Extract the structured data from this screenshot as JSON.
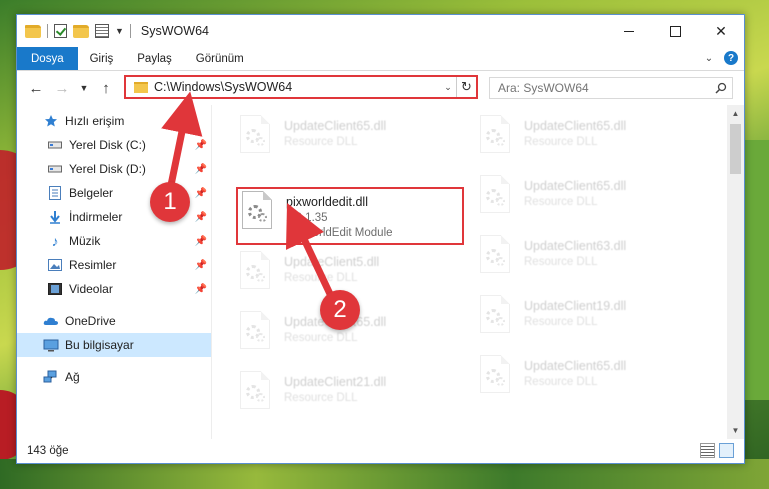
{
  "window": {
    "title": "SysWOW64"
  },
  "ribbon": {
    "tabs": [
      "Dosya",
      "Giriş",
      "Paylaş",
      "Görünüm"
    ],
    "help_symbol": "?"
  },
  "address": {
    "path": "C:\\Windows\\SysWOW64",
    "search_placeholder": "Ara: SysWOW64"
  },
  "nav": {
    "quick_access": "Hızlı erişim",
    "pinned": [
      {
        "label": "Yerel Disk (C:)",
        "icon": "drive-icon"
      },
      {
        "label": "Yerel Disk (D:)",
        "icon": "drive-icon"
      },
      {
        "label": "Belgeler",
        "icon": "documents-icon"
      },
      {
        "label": "İndirmeler",
        "icon": "downloads-icon"
      },
      {
        "label": "Müzik",
        "icon": "music-icon"
      },
      {
        "label": "Resimler",
        "icon": "pictures-icon"
      },
      {
        "label": "Videolar",
        "icon": "videos-icon"
      }
    ],
    "onedrive": "OneDrive",
    "this_pc": "Bu bilgisayar",
    "network": "Ağ"
  },
  "files": {
    "focused": {
      "name": "pixworldedit.dll",
      "version": "1.0.1.35",
      "description": "PixWorldEdit Module"
    },
    "faded": [
      {
        "name": "UpdateClient65.dll",
        "sub": "Resource DLL"
      },
      {
        "name": "UpdateClient65.dll",
        "sub": "Resource DLL"
      },
      {
        "name": "UpdateClient65.dll",
        "sub": "Resource DLL"
      },
      {
        "name": "UpdateClient5.dll",
        "sub": "Resource DLL"
      },
      {
        "name": "UpdateClient63.dll",
        "sub": "Resource DLL"
      },
      {
        "name": "UpdateClient65.dll",
        "sub": "Resource DLL"
      },
      {
        "name": "UpdateClient19.dll",
        "sub": "Resource DLL"
      },
      {
        "name": "UpdateClient21.dll",
        "sub": "Resource DLL"
      },
      {
        "name": "UpdateClient65.dll",
        "sub": "Resource DLL"
      }
    ]
  },
  "status": {
    "count": "143 öğe"
  },
  "callouts": [
    "1",
    "2"
  ],
  "colors": {
    "highlight": "#e0363a",
    "accent": "#1979ca",
    "selected_nav": "#cce8ff"
  }
}
